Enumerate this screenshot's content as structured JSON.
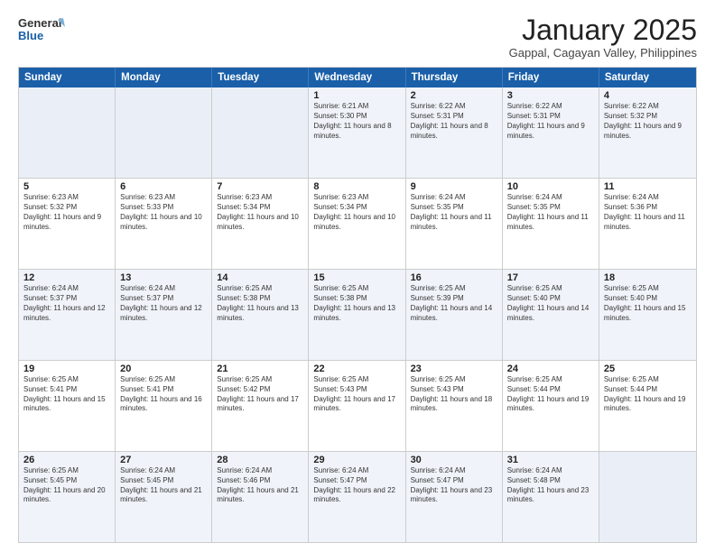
{
  "logo": {
    "line1": "General",
    "line2": "Blue"
  },
  "title": "January 2025",
  "location": "Gappal, Cagayan Valley, Philippines",
  "headers": [
    "Sunday",
    "Monday",
    "Tuesday",
    "Wednesday",
    "Thursday",
    "Friday",
    "Saturday"
  ],
  "rows": [
    [
      {
        "day": "",
        "info": ""
      },
      {
        "day": "",
        "info": ""
      },
      {
        "day": "",
        "info": ""
      },
      {
        "day": "1",
        "info": "Sunrise: 6:21 AM\nSunset: 5:30 PM\nDaylight: 11 hours and 8 minutes."
      },
      {
        "day": "2",
        "info": "Sunrise: 6:22 AM\nSunset: 5:31 PM\nDaylight: 11 hours and 8 minutes."
      },
      {
        "day": "3",
        "info": "Sunrise: 6:22 AM\nSunset: 5:31 PM\nDaylight: 11 hours and 9 minutes."
      },
      {
        "day": "4",
        "info": "Sunrise: 6:22 AM\nSunset: 5:32 PM\nDaylight: 11 hours and 9 minutes."
      }
    ],
    [
      {
        "day": "5",
        "info": "Sunrise: 6:23 AM\nSunset: 5:32 PM\nDaylight: 11 hours and 9 minutes."
      },
      {
        "day": "6",
        "info": "Sunrise: 6:23 AM\nSunset: 5:33 PM\nDaylight: 11 hours and 10 minutes."
      },
      {
        "day": "7",
        "info": "Sunrise: 6:23 AM\nSunset: 5:34 PM\nDaylight: 11 hours and 10 minutes."
      },
      {
        "day": "8",
        "info": "Sunrise: 6:23 AM\nSunset: 5:34 PM\nDaylight: 11 hours and 10 minutes."
      },
      {
        "day": "9",
        "info": "Sunrise: 6:24 AM\nSunset: 5:35 PM\nDaylight: 11 hours and 11 minutes."
      },
      {
        "day": "10",
        "info": "Sunrise: 6:24 AM\nSunset: 5:35 PM\nDaylight: 11 hours and 11 minutes."
      },
      {
        "day": "11",
        "info": "Sunrise: 6:24 AM\nSunset: 5:36 PM\nDaylight: 11 hours and 11 minutes."
      }
    ],
    [
      {
        "day": "12",
        "info": "Sunrise: 6:24 AM\nSunset: 5:37 PM\nDaylight: 11 hours and 12 minutes."
      },
      {
        "day": "13",
        "info": "Sunrise: 6:24 AM\nSunset: 5:37 PM\nDaylight: 11 hours and 12 minutes."
      },
      {
        "day": "14",
        "info": "Sunrise: 6:25 AM\nSunset: 5:38 PM\nDaylight: 11 hours and 13 minutes."
      },
      {
        "day": "15",
        "info": "Sunrise: 6:25 AM\nSunset: 5:38 PM\nDaylight: 11 hours and 13 minutes."
      },
      {
        "day": "16",
        "info": "Sunrise: 6:25 AM\nSunset: 5:39 PM\nDaylight: 11 hours and 14 minutes."
      },
      {
        "day": "17",
        "info": "Sunrise: 6:25 AM\nSunset: 5:40 PM\nDaylight: 11 hours and 14 minutes."
      },
      {
        "day": "18",
        "info": "Sunrise: 6:25 AM\nSunset: 5:40 PM\nDaylight: 11 hours and 15 minutes."
      }
    ],
    [
      {
        "day": "19",
        "info": "Sunrise: 6:25 AM\nSunset: 5:41 PM\nDaylight: 11 hours and 15 minutes."
      },
      {
        "day": "20",
        "info": "Sunrise: 6:25 AM\nSunset: 5:41 PM\nDaylight: 11 hours and 16 minutes."
      },
      {
        "day": "21",
        "info": "Sunrise: 6:25 AM\nSunset: 5:42 PM\nDaylight: 11 hours and 17 minutes."
      },
      {
        "day": "22",
        "info": "Sunrise: 6:25 AM\nSunset: 5:43 PM\nDaylight: 11 hours and 17 minutes."
      },
      {
        "day": "23",
        "info": "Sunrise: 6:25 AM\nSunset: 5:43 PM\nDaylight: 11 hours and 18 minutes."
      },
      {
        "day": "24",
        "info": "Sunrise: 6:25 AM\nSunset: 5:44 PM\nDaylight: 11 hours and 19 minutes."
      },
      {
        "day": "25",
        "info": "Sunrise: 6:25 AM\nSunset: 5:44 PM\nDaylight: 11 hours and 19 minutes."
      }
    ],
    [
      {
        "day": "26",
        "info": "Sunrise: 6:25 AM\nSunset: 5:45 PM\nDaylight: 11 hours and 20 minutes."
      },
      {
        "day": "27",
        "info": "Sunrise: 6:24 AM\nSunset: 5:45 PM\nDaylight: 11 hours and 21 minutes."
      },
      {
        "day": "28",
        "info": "Sunrise: 6:24 AM\nSunset: 5:46 PM\nDaylight: 11 hours and 21 minutes."
      },
      {
        "day": "29",
        "info": "Sunrise: 6:24 AM\nSunset: 5:47 PM\nDaylight: 11 hours and 22 minutes."
      },
      {
        "day": "30",
        "info": "Sunrise: 6:24 AM\nSunset: 5:47 PM\nDaylight: 11 hours and 23 minutes."
      },
      {
        "day": "31",
        "info": "Sunrise: 6:24 AM\nSunset: 5:48 PM\nDaylight: 11 hours and 23 minutes."
      },
      {
        "day": "",
        "info": ""
      }
    ]
  ],
  "alt_rows": [
    0,
    2,
    4
  ]
}
